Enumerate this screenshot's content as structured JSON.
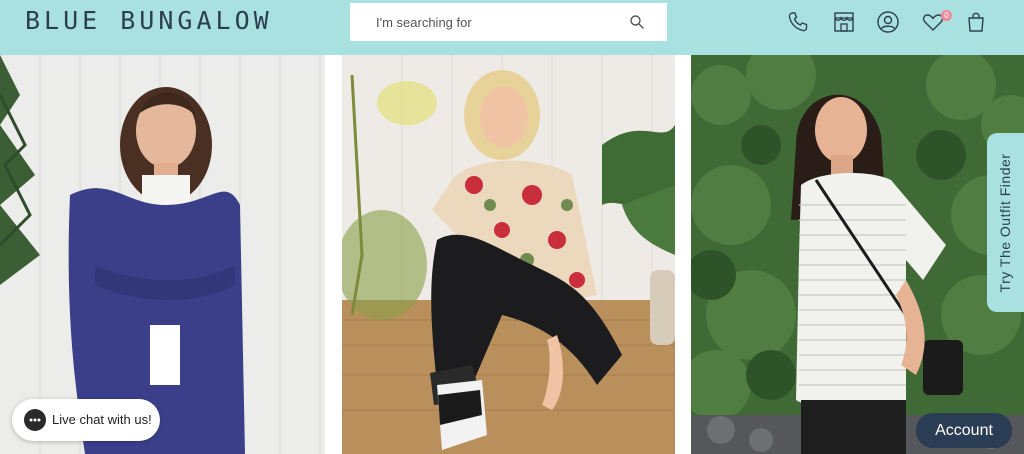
{
  "header": {
    "logo": "BLUE BUNGALOW",
    "search": {
      "placeholder": "I'm searching for"
    },
    "icons": [
      "phone-icon",
      "store-icon",
      "user-icon",
      "heart-icon",
      "bag-icon"
    ],
    "wishlist_count": "0"
  },
  "chat": {
    "label": "Live chat with us!"
  },
  "outfit_tab": {
    "label": "Try The Outfit Finder"
  },
  "account": {
    "label": "Account"
  },
  "colors": {
    "header_bg": "#a8e1e0",
    "brand_text": "#2c3f4f",
    "account_bg": "#2b3d55",
    "badge": "#f08b9c"
  }
}
